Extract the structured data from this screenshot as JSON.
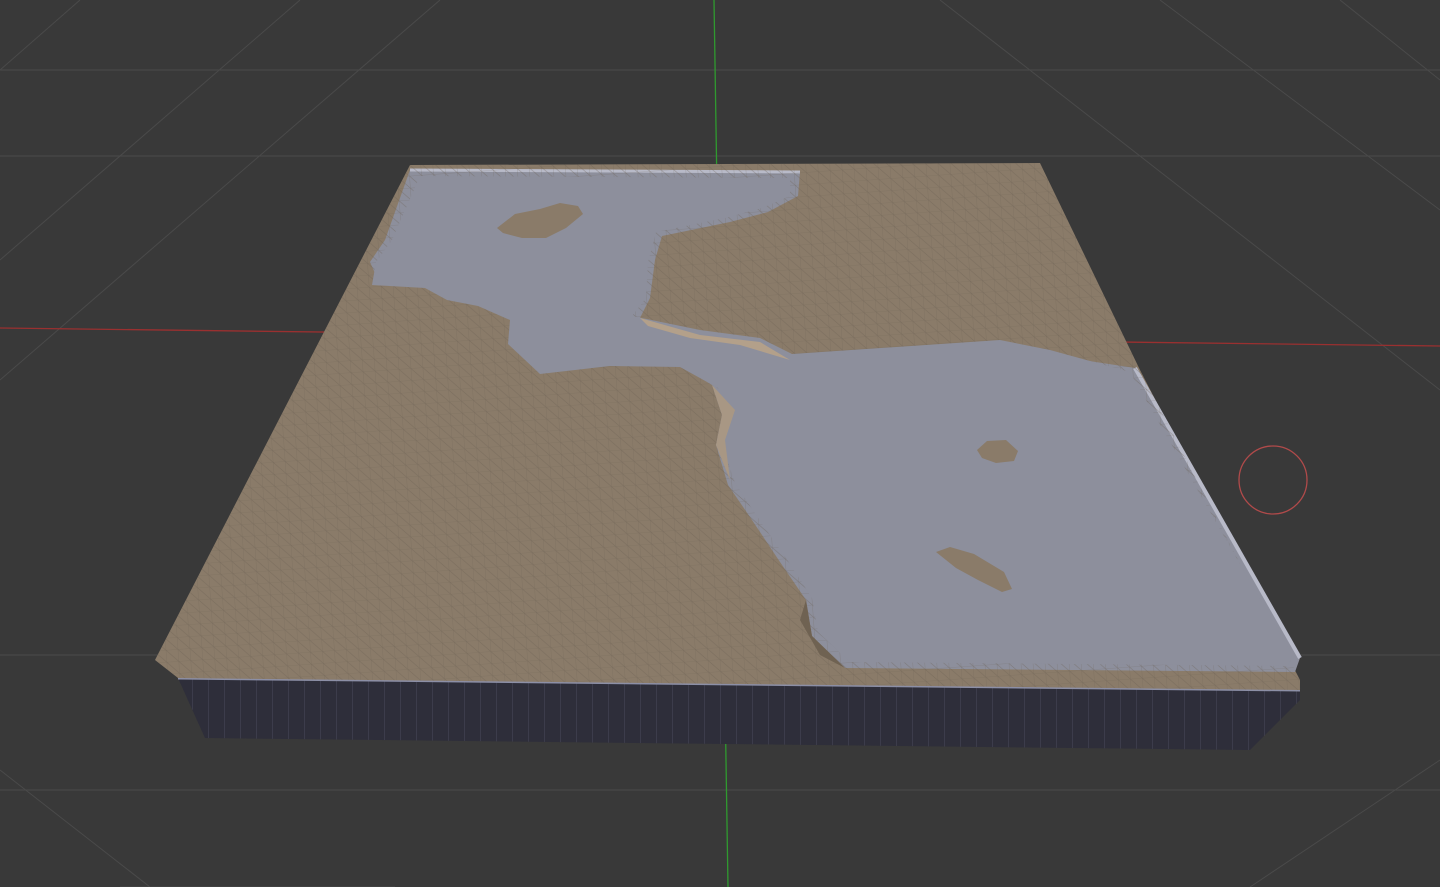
{
  "viewport": {
    "name": "3d-viewport",
    "background": "#393939",
    "grid_color": "#4a4a4a",
    "x_axis_color": "#9a3030",
    "y_axis_color": "#2f9a2f"
  },
  "terrain": {
    "land_color": "#8a7b69",
    "land_shade_color": "#6f6252",
    "water_color": "#8d8f9c",
    "base_side_color": "#2e2e3a",
    "wire_color": "#5d5346"
  },
  "gizmo": {
    "icon": "view-pivot-circle-icon",
    "color": "#b04a4a"
  }
}
